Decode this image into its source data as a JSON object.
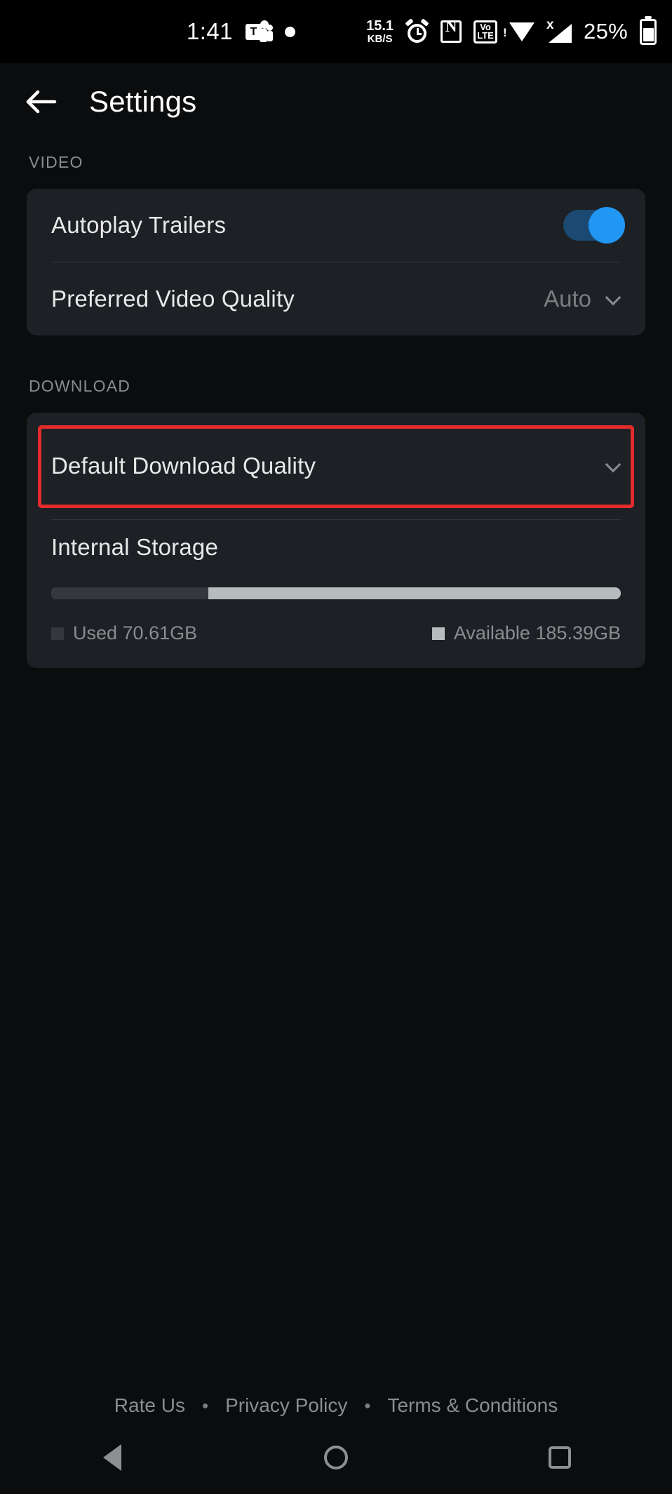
{
  "status_bar": {
    "time": "1:41",
    "teams_icon": "microsoft-teams-icon",
    "teams_letter": "T",
    "dot_icon": "dot-indicator-icon",
    "net_speed_value": "15.1",
    "net_speed_unit": "KB/S",
    "alarm_icon": "alarm-clock-icon",
    "nfc_icon": "nfc-icon",
    "nfc_letter": "N",
    "volte_line1": "Vo",
    "volte_line2": "LTE",
    "wifi_icon": "wifi-no-internet-icon",
    "wifi_badge": "!",
    "signal_icon": "cellular-signal-icon",
    "signal_badge": "x",
    "battery_percent": "25%",
    "battery_icon": "battery-icon"
  },
  "appbar": {
    "back_icon": "back-arrow-icon",
    "title": "Settings"
  },
  "sections": {
    "video": {
      "label": "VIDEO",
      "autoplay": {
        "label": "Autoplay Trailers",
        "toggle_state": "on",
        "toggle_icon": "toggle-switch-on-icon"
      },
      "preferred_quality": {
        "label": "Preferred Video Quality",
        "value": "Auto",
        "chevron_icon": "chevron-down-icon"
      }
    },
    "download": {
      "label": "DOWNLOAD",
      "default_quality": {
        "label": "Default Download Quality",
        "chevron_icon": "chevron-down-icon",
        "highlight_color": "#E32B2B"
      },
      "storage": {
        "title": "Internal Storage",
        "used_label": "Used 70.61GB",
        "available_label": "Available 185.39GB",
        "used_percent": 27.6,
        "used_color": "#34383C",
        "available_color": "#B6BCBE"
      }
    }
  },
  "footer": {
    "rate_us": "Rate Us",
    "separator": "•",
    "privacy_policy": "Privacy Policy",
    "terms": "Terms & Conditions"
  },
  "navbar": {
    "back_icon": "nav-back-triangle-icon",
    "home_icon": "nav-home-circle-icon",
    "recents_icon": "nav-recents-square-icon"
  },
  "theme": {
    "background": "#0B0C0D",
    "card": "#1D2024",
    "accent_blue": "#2196F3",
    "muted_text": "#8A8D90"
  }
}
